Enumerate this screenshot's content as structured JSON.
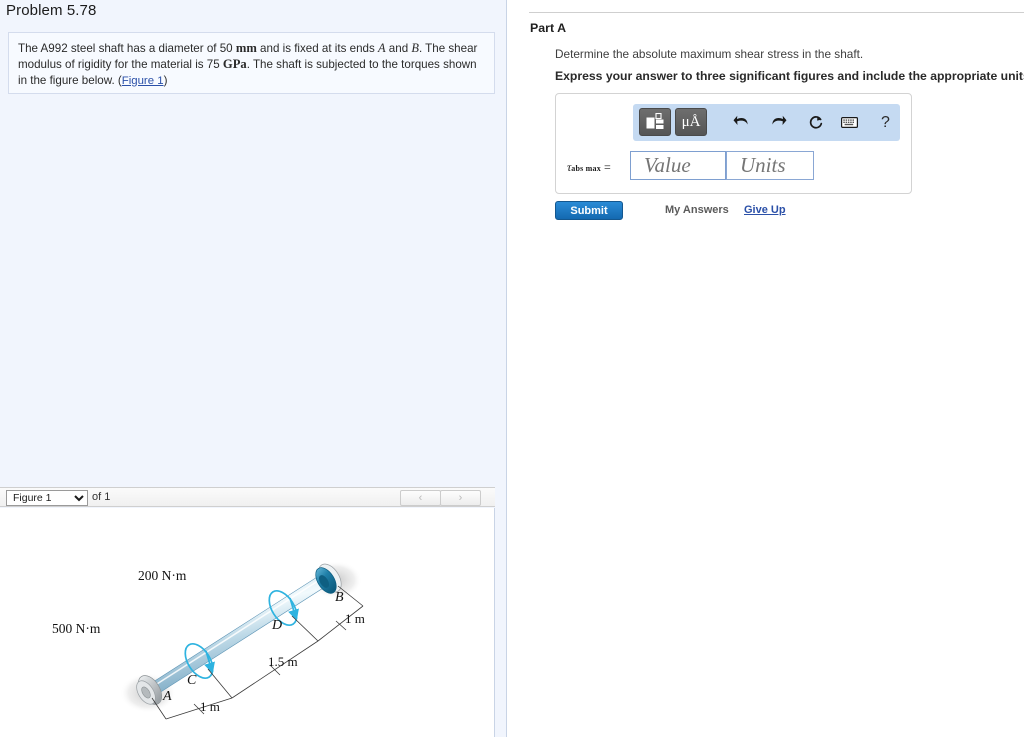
{
  "left": {
    "problem_title": "Problem 5.78",
    "statement": {
      "part1": "The A992 steel shaft has a diameter of 50 ",
      "unit1": "mm",
      "part2": " and is fixed at its ends ",
      "italic1": "A",
      "part3": " and ",
      "italic2": "B",
      "part4": ". The shear modulus of rigidity for the material is 75 ",
      "unit2": "GPa",
      "part5": ". The shaft is subjected to the torques shown in the figure below. (",
      "link": "Figure 1",
      "part6": ")"
    },
    "figure_toolbar": {
      "selected_figure": "Figure 1",
      "options": [
        "Figure 1"
      ],
      "count_label": "of 1",
      "prev_label": "‹",
      "next_label": "›"
    }
  },
  "right": {
    "part_label": "Part A",
    "question": "Determine the absolute maximum shear stress in the shaft.",
    "instruction": "Express your answer to three significant figures and include the appropriate units.",
    "toolbar": {
      "template_icon": "template-icon",
      "units_label": "μÅ",
      "undo_icon": "undo-icon",
      "redo_icon": "redo-icon",
      "reset_icon": "reset-icon",
      "keyboard_icon": "keyboard-icon",
      "help_label": "?"
    },
    "answer": {
      "symbol": "τ",
      "subscript": "abs max",
      "equals": "=",
      "value_placeholder": "Value",
      "units_placeholder": "Units",
      "value": "",
      "units": ""
    },
    "submit_label": "Submit",
    "my_answers_label": "My Answers",
    "give_up_label": "Give Up"
  },
  "figure": {
    "labels": {
      "torque_left": "500 N·m",
      "torque_right": "200 N·m",
      "point_a": "A",
      "point_b": "B",
      "point_c": "C",
      "point_d": "D",
      "dim_ac": "1 m",
      "dim_cd": "1.5 m",
      "dim_db": "1 m"
    },
    "colors": {
      "shaft_light": "#dcecf4",
      "shaft_mid": "#9fc8dc",
      "shaft_dark": "#5c93b4",
      "torque_arrow": "#2eb3e0",
      "flange_blue": "#1f7fa8",
      "flange_gray": "#c9cdd0"
    }
  },
  "theme": {
    "left_panel_bg": "#f1f5fd",
    "statement_bg": "#f7faff",
    "accent_blue": "#1469b0",
    "link_blue": "#2b50a8",
    "toolbar_blue": "#c5daf2"
  }
}
